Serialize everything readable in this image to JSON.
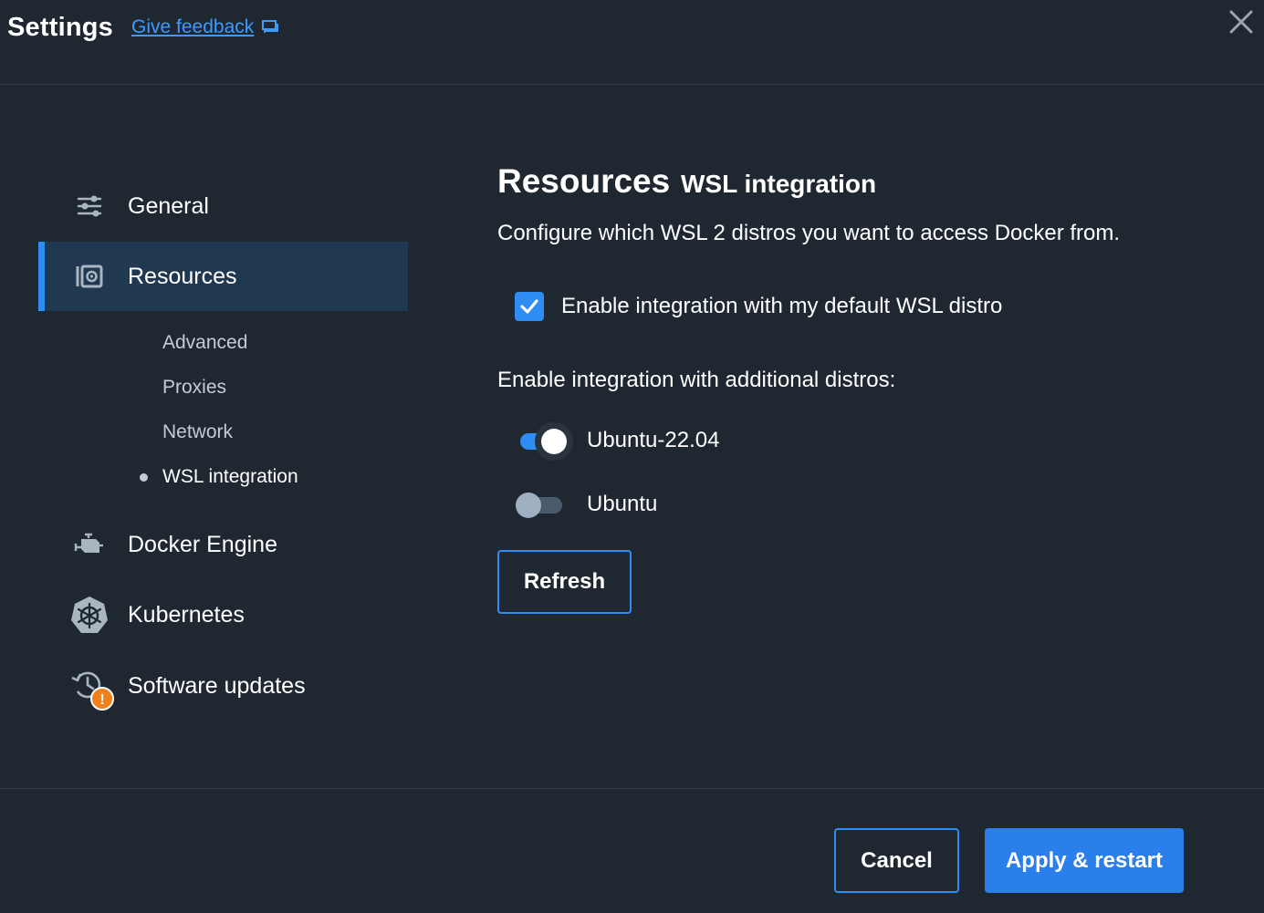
{
  "header": {
    "title": "Settings",
    "feedback_label": "Give feedback"
  },
  "sidebar": {
    "items": [
      {
        "label": "General",
        "icon": "sliders-icon"
      },
      {
        "label": "Resources",
        "icon": "resources-icon",
        "active": true
      },
      {
        "label": "Docker Engine",
        "icon": "engine-icon"
      },
      {
        "label": "Kubernetes",
        "icon": "kubernetes-icon"
      },
      {
        "label": "Software updates",
        "icon": "update-history-icon",
        "badge": "!"
      }
    ],
    "subitems": [
      {
        "label": "Advanced"
      },
      {
        "label": "Proxies"
      },
      {
        "label": "Network"
      },
      {
        "label": "WSL integration",
        "current": true
      }
    ]
  },
  "main": {
    "title": "Resources",
    "subtitle": "WSL integration",
    "description": "Configure which WSL 2 distros you want to access Docker from.",
    "default_distro": {
      "label": "Enable integration with my default WSL distro",
      "checked": true
    },
    "additional_heading": "Enable integration with additional distros:",
    "distros": [
      {
        "name": "Ubuntu-22.04",
        "enabled": true
      },
      {
        "name": "Ubuntu",
        "enabled": false
      }
    ],
    "refresh_label": "Refresh"
  },
  "footer": {
    "cancel_label": "Cancel",
    "apply_label": "Apply & restart"
  },
  "colors": {
    "background": "#1f2831",
    "accent": "#2e8cf5",
    "active_nav": "#213851",
    "warning_badge": "#f0801a",
    "link": "#3d9bff"
  }
}
